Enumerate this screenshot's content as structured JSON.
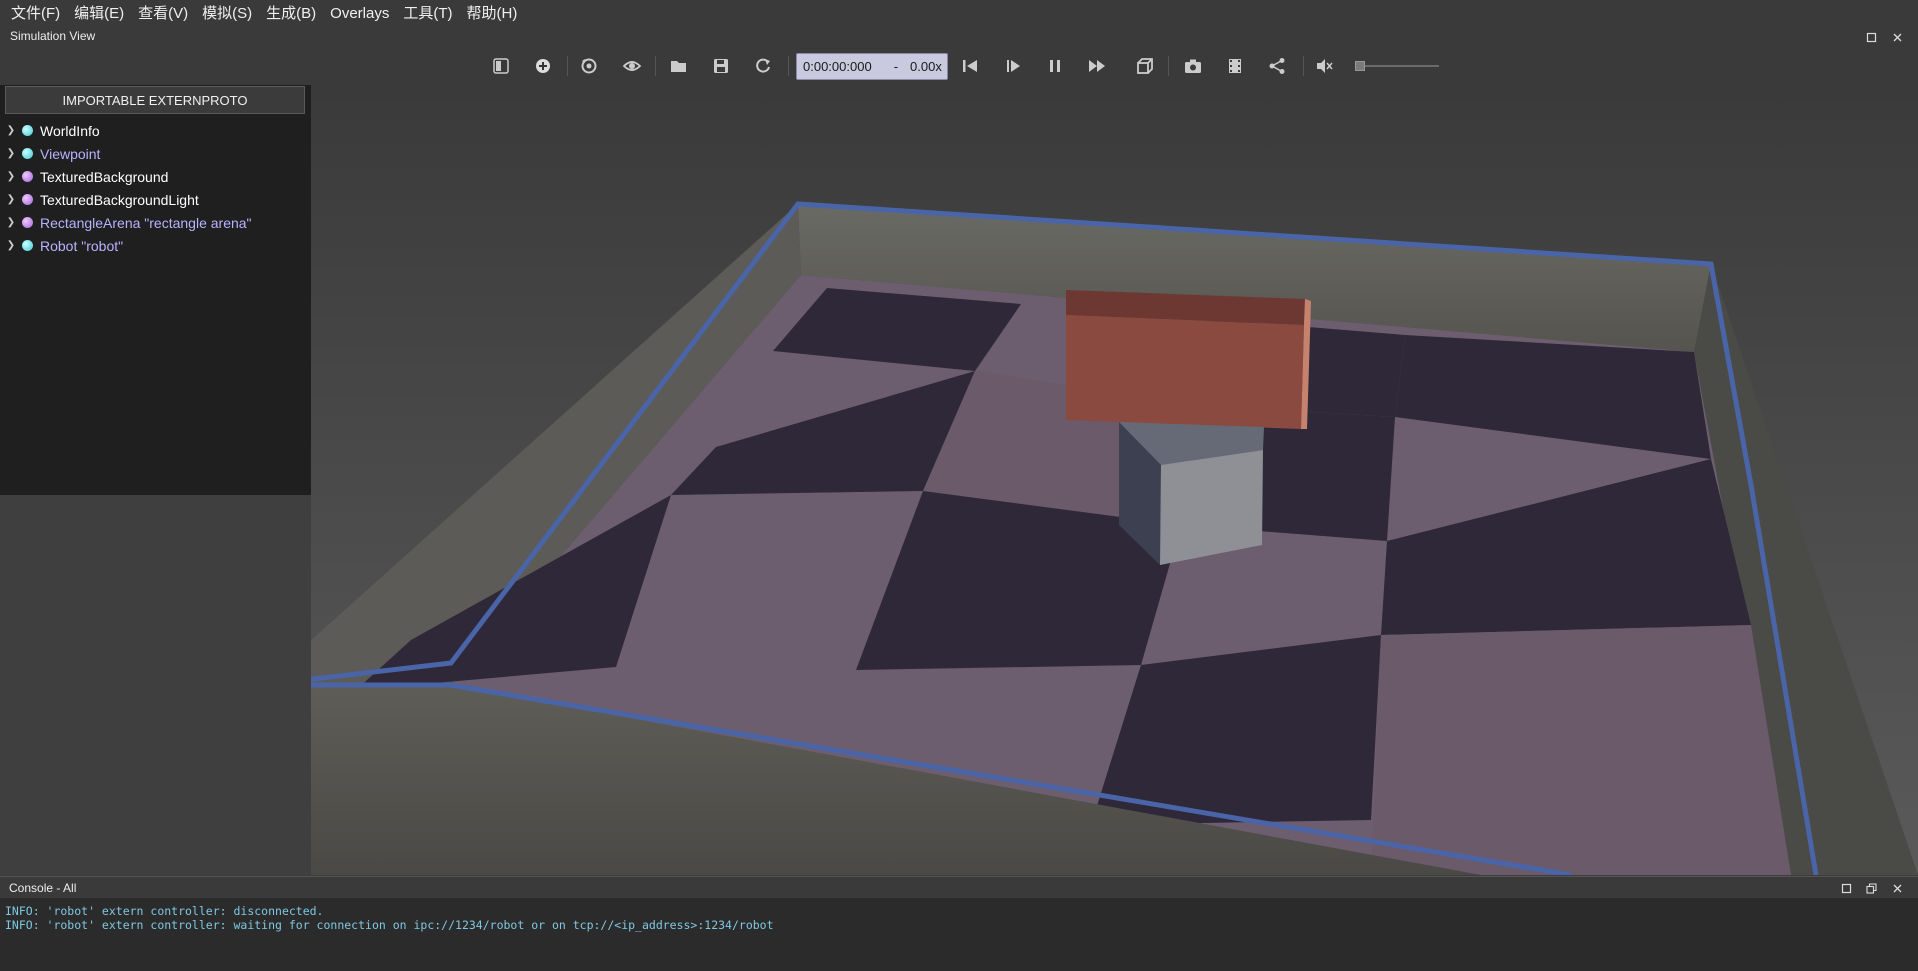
{
  "menubar": {
    "items": [
      "文件(F)",
      "编辑(E)",
      "查看(V)",
      "模拟(S)",
      "生成(B)",
      "Overlays",
      "工具(T)",
      "帮助(H)"
    ]
  },
  "simulation_view": {
    "title": "Simulation View"
  },
  "toolbar": {
    "buttons": [
      "toggle-scene-tree-icon",
      "add-node-icon",
      "reset-view-icon",
      "eye-icon",
      "open-folder-icon",
      "save-icon",
      "reload-icon",
      "step-back-icon",
      "play-step-icon",
      "pause-icon",
      "fast-forward-icon",
      "cube-view-icon",
      "camera-icon",
      "movie-icon",
      "share-icon",
      "mute-icon"
    ],
    "time": "0:00:00:000",
    "dash": "-",
    "speed": "0.00x",
    "volume": 0
  },
  "scene_tree": {
    "extern_button": "IMPORTABLE EXTERNPROTO",
    "nodes": [
      {
        "label": "WorldInfo",
        "dot": "cyan",
        "color": "white"
      },
      {
        "label": "Viewpoint",
        "dot": "cyan",
        "color": "lavender"
      },
      {
        "label": "TexturedBackground",
        "dot": "purple",
        "color": "white"
      },
      {
        "label": "TexturedBackgroundLight",
        "dot": "purple",
        "color": "white"
      },
      {
        "label": "RectangleArena \"rectangle arena\"",
        "dot": "purple",
        "color": "lavender"
      },
      {
        "label": "Robot \"robot\"",
        "dot": "cyan",
        "color": "lavender"
      }
    ]
  },
  "console": {
    "title": "Console - All",
    "lines": [
      "INFO: 'robot' extern controller: disconnected.",
      "INFO: 'robot' extern controller: waiting for connection on ipc://1234/robot or on tcp://<ip_address>:1234/robot"
    ]
  },
  "colors": {
    "accent_border": "#4a64a8",
    "console_text": "#7ec8e3",
    "orange_box": "#8a4a40",
    "grey_box": "#8f9096"
  }
}
